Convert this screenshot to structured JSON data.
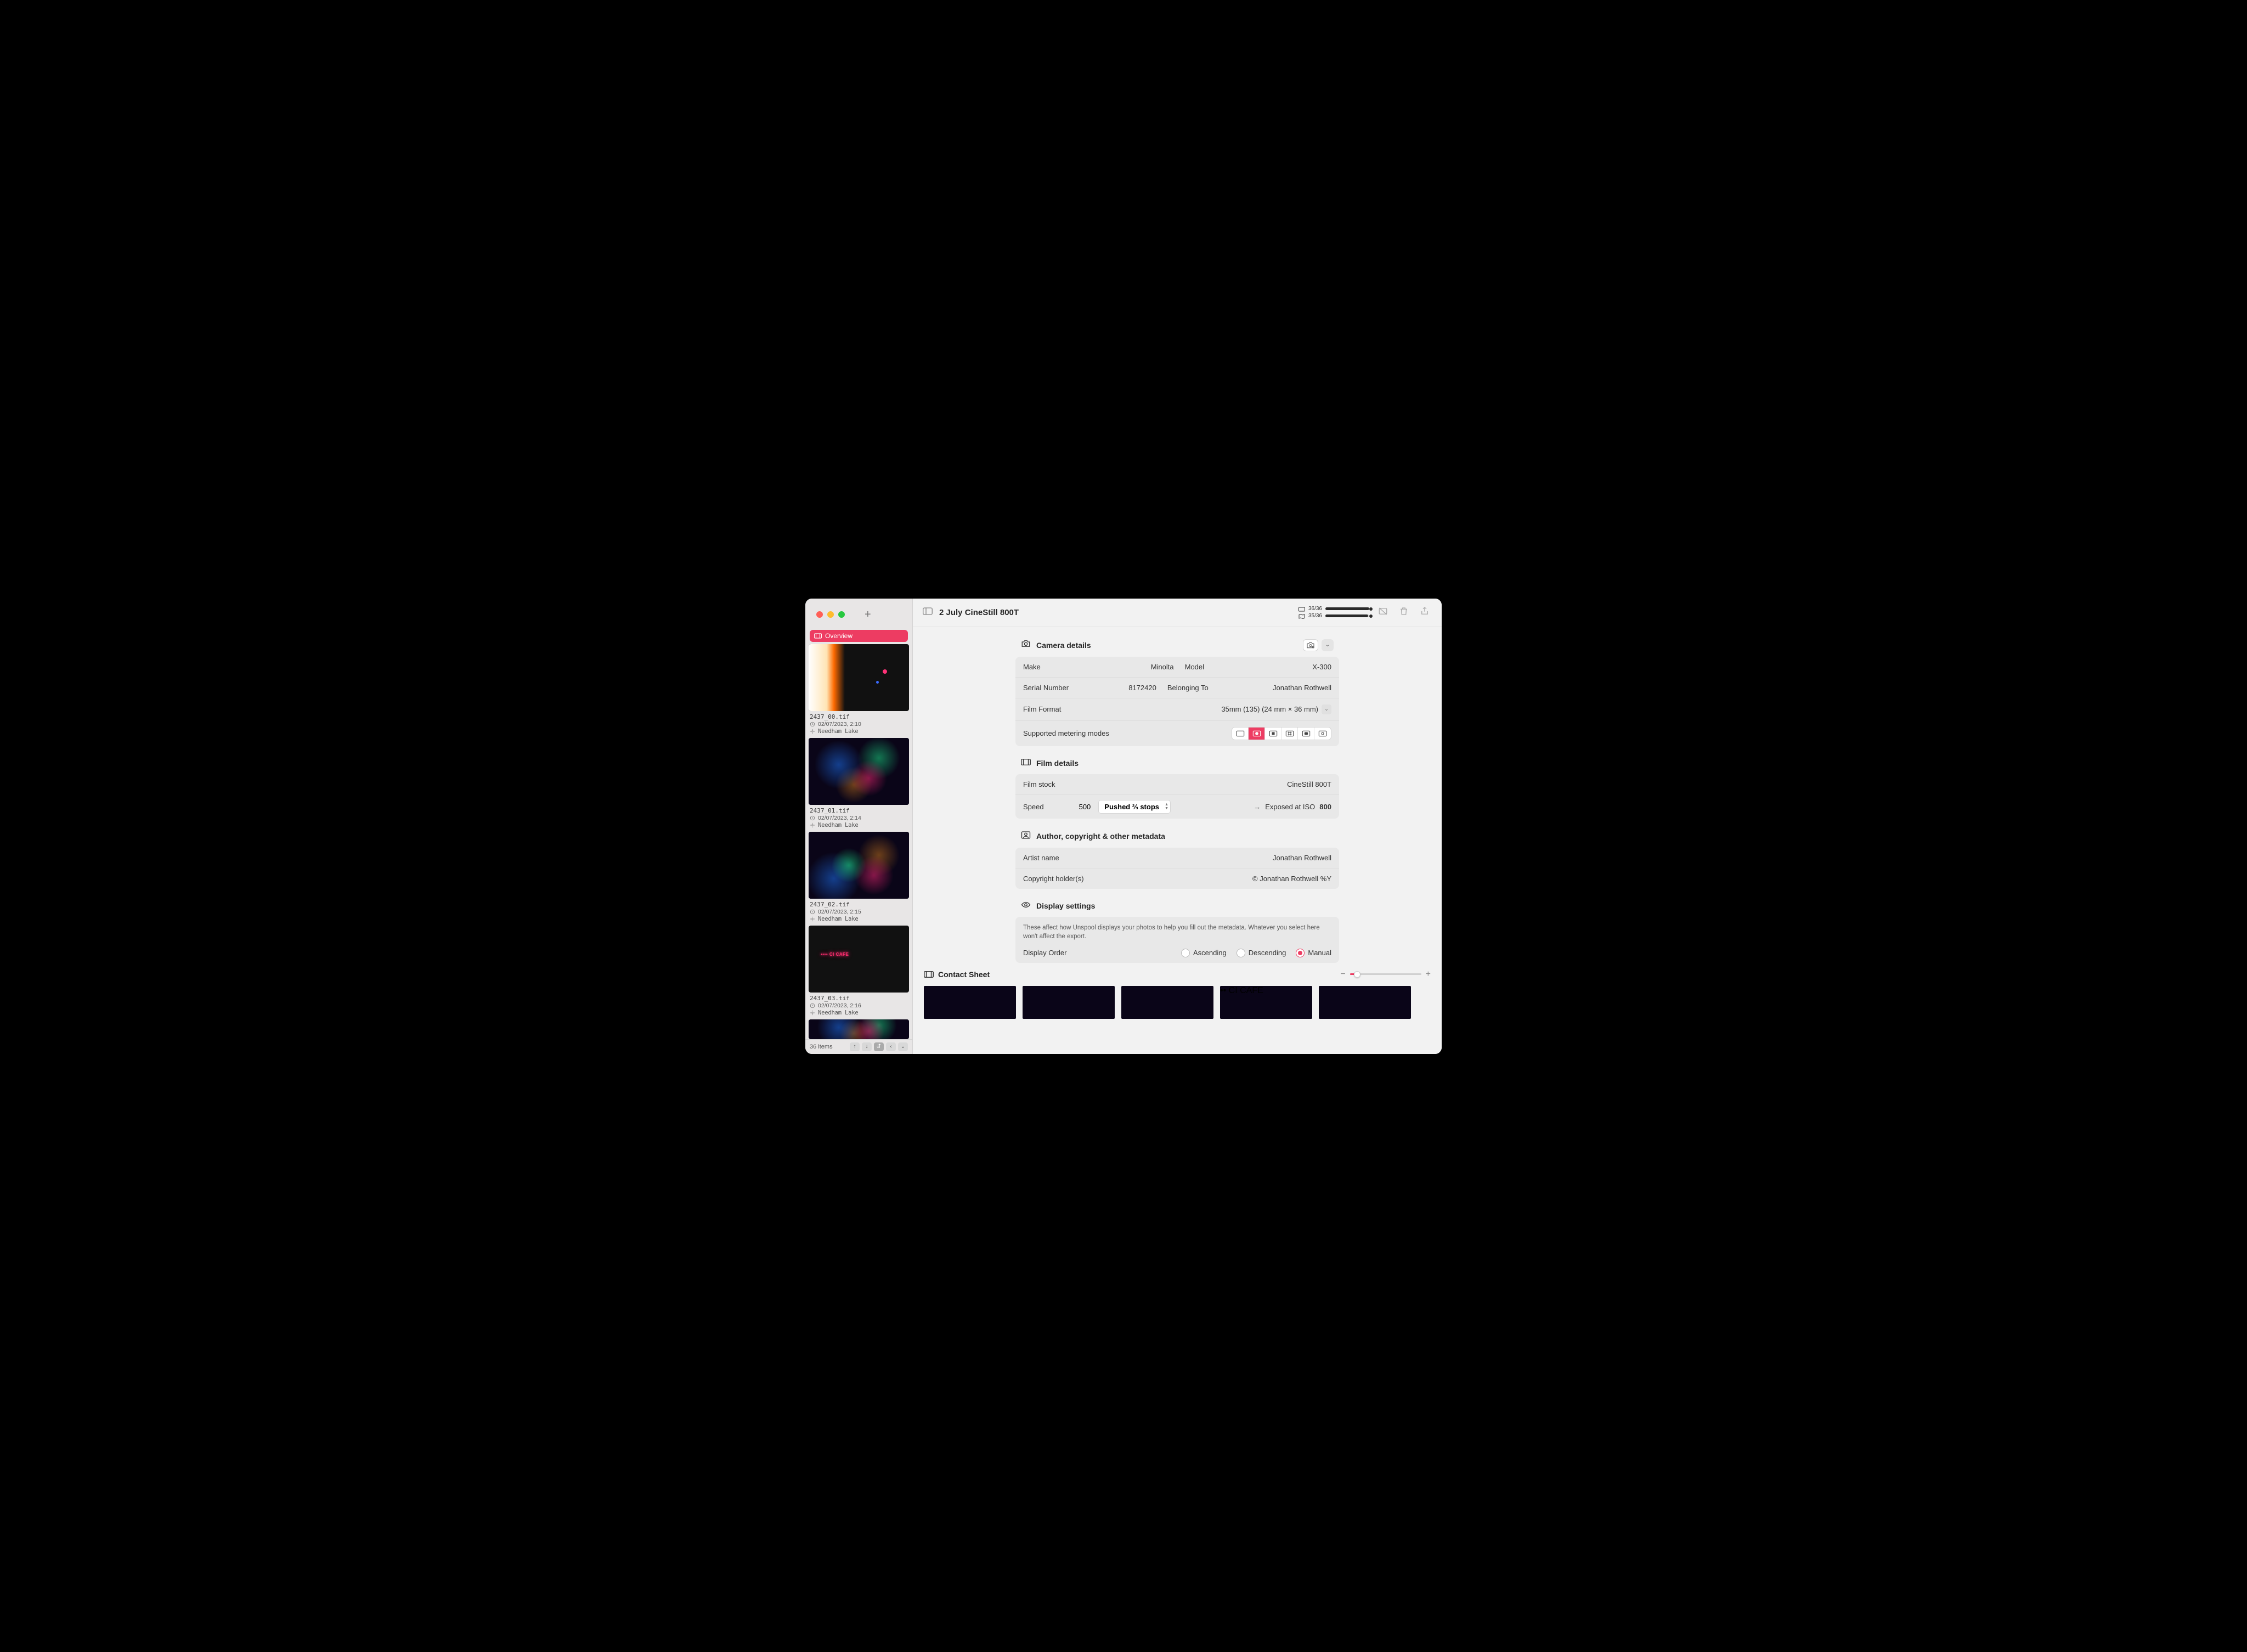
{
  "window": {
    "title": "2 July CineStill 800T"
  },
  "sidebar": {
    "overview_label": "Overview",
    "items": [
      {
        "filename": "2437_00.tif",
        "timestamp": "02/07/2023, 2:10",
        "location": "Needham Lake",
        "variant": "fire"
      },
      {
        "filename": "2437_01.tif",
        "timestamp": "02/07/2023, 2:14",
        "location": "Needham Lake",
        "variant": "disco"
      },
      {
        "filename": "2437_02.tif",
        "timestamp": "02/07/2023, 2:15",
        "location": "Needham Lake",
        "variant": "disco"
      },
      {
        "filename": "2437_03.tif",
        "timestamp": "02/07/2023, 2:16",
        "location": "Needham Lake",
        "variant": "neon"
      }
    ],
    "footer_count": "36 items"
  },
  "toolbar": {
    "counter_top": "36/36",
    "counter_bottom": "35/36"
  },
  "camera": {
    "section_title": "Camera details",
    "make_label": "Make",
    "make_value": "Minolta",
    "model_label": "Model",
    "model_value": "X-300",
    "serial_label": "Serial Number",
    "serial_value": "8172420",
    "belonging_label": "Belonging To",
    "belonging_value": "Jonathan Rothwell",
    "format_label": "Film Format",
    "format_value": "35mm (135) (24 mm × 36 mm)",
    "metering_label": "Supported metering modes"
  },
  "film": {
    "section_title": "Film details",
    "stock_label": "Film stock",
    "stock_value": "CineStill 800T",
    "speed_label": "Speed",
    "speed_value": "500",
    "push_value": "Pushed ⅔ stops",
    "expose_prefix": "Exposed at ISO",
    "expose_iso": "800"
  },
  "author": {
    "section_title": "Author, copyright & other metadata",
    "artist_label": "Artist name",
    "artist_value": "Jonathan Rothwell",
    "copyright_label": "Copyright holder(s)",
    "copyright_value": "© Jonathan Rothwell %Y"
  },
  "display": {
    "section_title": "Display settings",
    "note": "These affect how Unspool displays your photos to help you fill out the metadata. Whatever you select here won't affect the export.",
    "order_label": "Display Order",
    "options": {
      "ascending": "Ascending",
      "descending": "Descending",
      "manual": "Manual"
    },
    "selected": "manual"
  },
  "contact_sheet": {
    "title": "Contact Sheet"
  }
}
